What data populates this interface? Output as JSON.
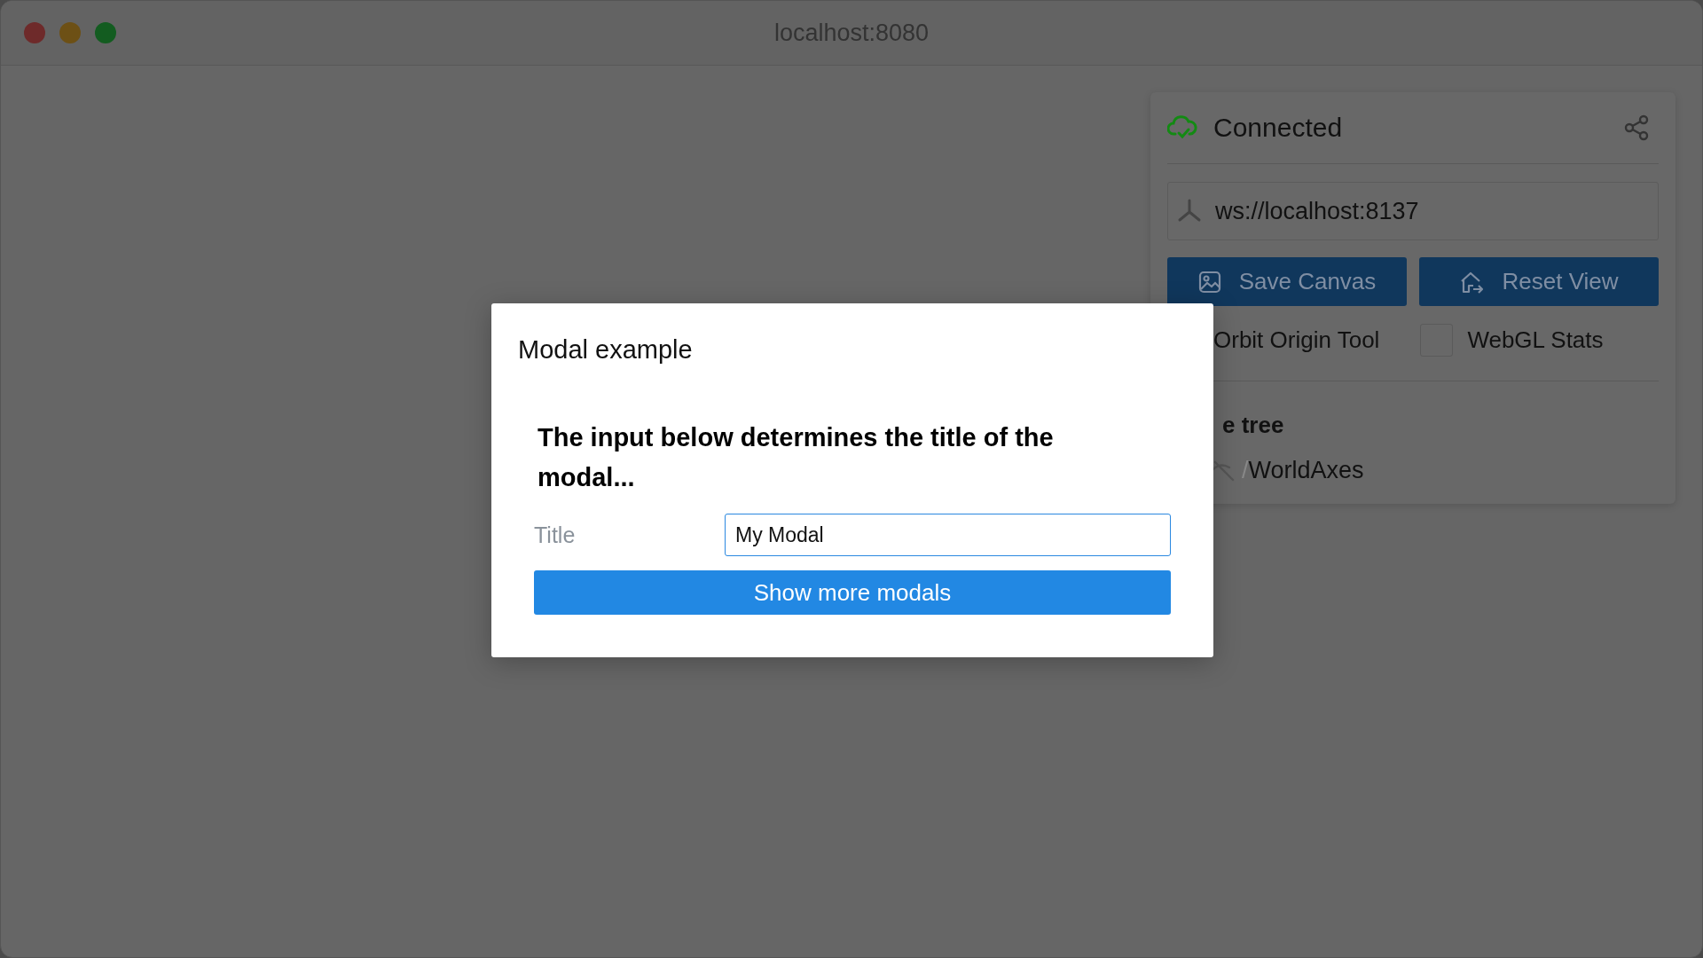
{
  "window": {
    "title": "localhost:8080"
  },
  "panel": {
    "status": "Connected",
    "connected": true,
    "server_url": "ws://localhost:8137",
    "buttons": [
      {
        "label": "Save Canvas",
        "kind": "save"
      },
      {
        "label": "Reset View",
        "kind": "reset"
      }
    ],
    "options": [
      {
        "label": "Orbit Origin Tool"
      },
      {
        "label": "WebGL Stats",
        "checked": false
      }
    ],
    "tree": {
      "heading": "e tree",
      "items": [
        {
          "prefix": "/",
          "name": "WorldAxes",
          "visible": false
        }
      ]
    }
  },
  "modal": {
    "title": "Modal example",
    "message": "The input below determines the title of the modal...",
    "field": {
      "label": "Title",
      "value": "My Modal"
    },
    "button": "Show more modals"
  }
}
